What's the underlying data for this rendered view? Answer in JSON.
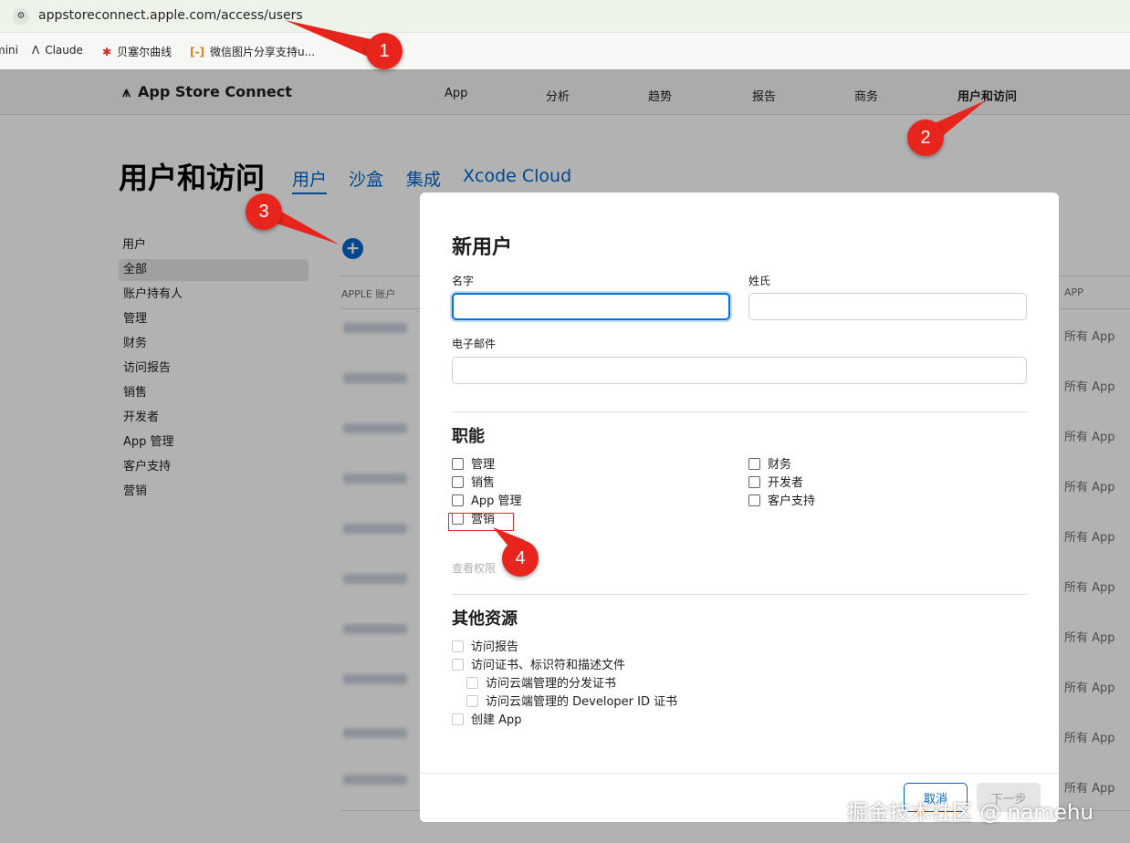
{
  "browser": {
    "url": "appstoreconnect.apple.com/access/users",
    "bookmarks": [
      {
        "label": "mini",
        "icon": ""
      },
      {
        "label": "Claude",
        "icon": "claude-icon"
      },
      {
        "label": "贝塞尔曲线",
        "icon": "bezier-icon"
      },
      {
        "label": "微信图片分享支持u...",
        "icon": "code-bracket-icon"
      }
    ]
  },
  "topnav": {
    "brand": "App Store Connect",
    "links": [
      "App",
      "分析",
      "趋势",
      "报告",
      "商务",
      "用户和访问"
    ],
    "active": "用户和访问"
  },
  "page": {
    "title": "用户和访问",
    "tabs": [
      "用户",
      "沙盒",
      "集成",
      "Xcode Cloud"
    ],
    "active_tab": "用户"
  },
  "sidebar": {
    "heading": "用户",
    "items": [
      "全部",
      "账户持有人",
      "管理",
      "财务",
      "访问报告",
      "销售",
      "开发者",
      "App 管理",
      "客户支持",
      "营销"
    ],
    "active": "全部"
  },
  "table": {
    "col_apple_account": "APPLE 账户",
    "col_app": "APP",
    "app_cells": [
      "所有 App",
      "所有 App",
      "所有 App",
      "所有 App",
      "所有 App",
      "所有 App",
      "所有 App",
      "所有 App",
      "所有 App",
      "所有 App"
    ]
  },
  "dialog": {
    "title": "新用户",
    "first_name_label": "名字",
    "last_name_label": "姓氏",
    "email_label": "电子邮件",
    "first_name_value": "",
    "last_name_value": "",
    "email_value": "",
    "roles_title": "职能",
    "roles_left": [
      "管理",
      "销售",
      "App 管理",
      "营销"
    ],
    "roles_right": [
      "财务",
      "开发者",
      "客户支持"
    ],
    "view_permissions": "查看权限",
    "resources_title": "其他资源",
    "resources": [
      "访问报告",
      "访问证书、标识符和描述文件"
    ],
    "resources_sub": [
      "访问云端管理的分发证书",
      "访问云端管理的 Developer ID 证书"
    ],
    "resource_last": "创建 App",
    "cancel_label": "取消",
    "next_label": "下一步"
  },
  "annotations": [
    "1",
    "2",
    "3",
    "4"
  ],
  "watermark": "掘金技术社区 @ namehu",
  "colors": {
    "accent": "#0066cc",
    "badge": "#e8251d"
  }
}
